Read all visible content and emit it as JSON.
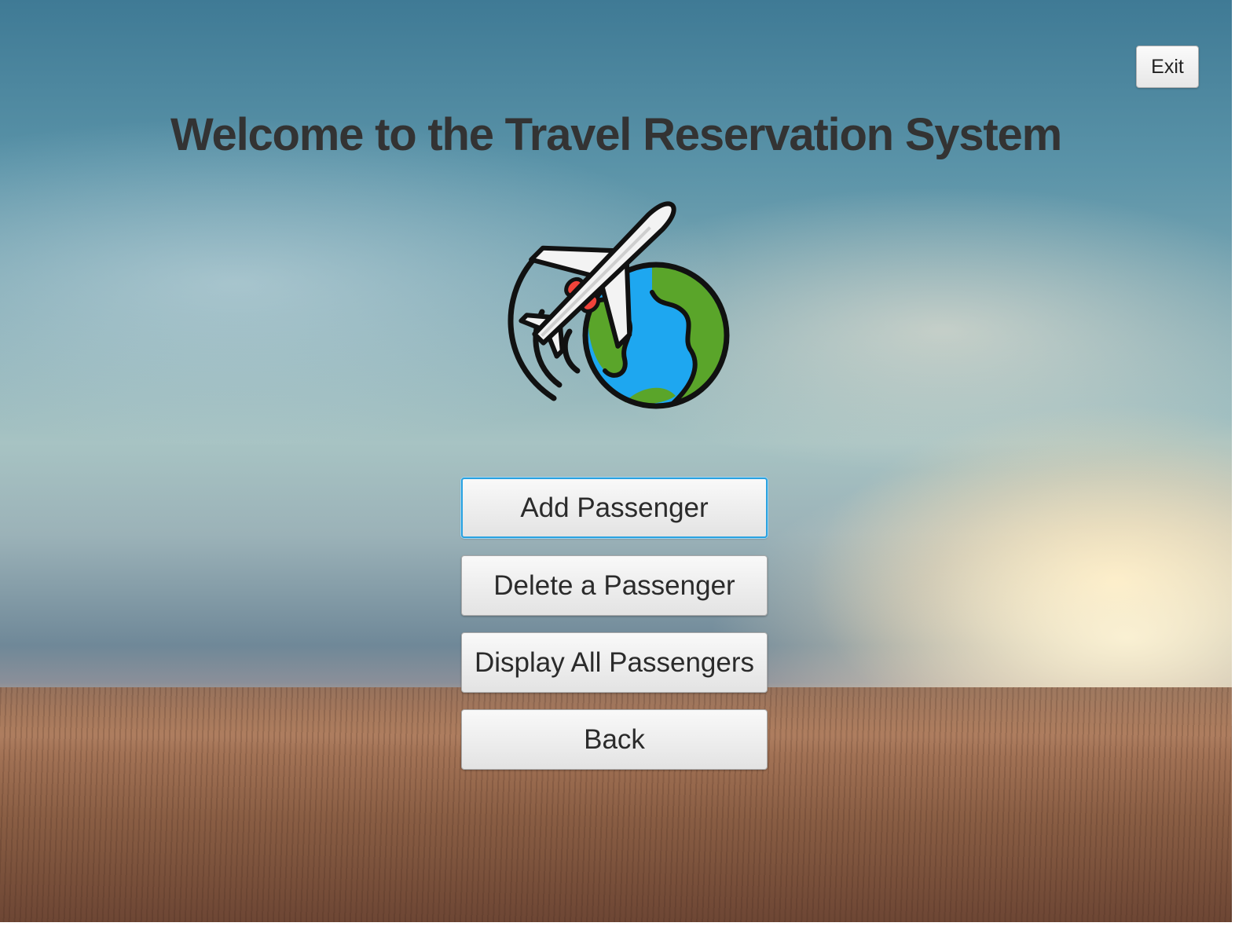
{
  "window": {
    "title": "Welcome to the Travel Reservation System"
  },
  "toolbar": {
    "exit_label": "Exit"
  },
  "logo": {
    "icon": "airplane-globe-icon"
  },
  "menu": {
    "buttons": [
      {
        "label": "Add Passenger",
        "focused": true
      },
      {
        "label": "Delete a Passenger",
        "focused": false
      },
      {
        "label": "Display All Passengers",
        "focused": false
      },
      {
        "label": "Back",
        "focused": false
      }
    ]
  },
  "colors": {
    "title_text": "#333333",
    "focus_ring": "#2aa2e0",
    "globe_ocean": "#1ea7f0",
    "globe_land": "#5aa52a",
    "plane_engine": "#f0433a"
  }
}
